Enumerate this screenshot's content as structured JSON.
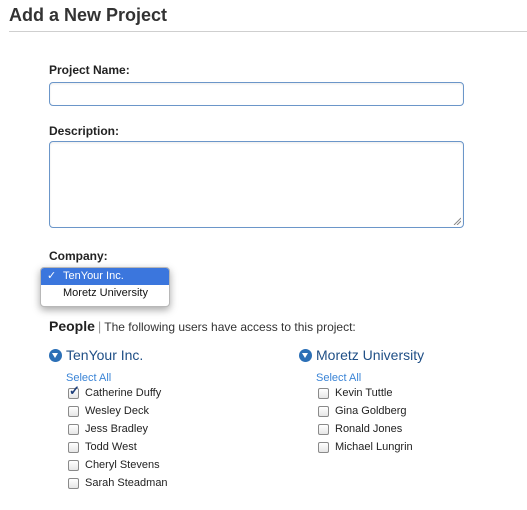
{
  "page": {
    "title": "Add a New Project"
  },
  "form": {
    "project_name_label": "Project Name:",
    "project_name_value": "",
    "description_label": "Description:",
    "description_value": "",
    "company_label": "Company:",
    "company_options": [
      "TenYour Inc.",
      "Moretz University"
    ],
    "company_selected": "TenYour Inc.",
    "checkmark": "✓"
  },
  "people": {
    "heading": "People",
    "separator": "|",
    "description": "The following users have access to this project:",
    "groups": [
      {
        "name": "TenYour Inc.",
        "select_all": "Select All",
        "members": [
          {
            "name": "Catherine Duffy",
            "checked": true
          },
          {
            "name": "Wesley Deck",
            "checked": false
          },
          {
            "name": "Jess Bradley",
            "checked": false
          },
          {
            "name": "Todd West",
            "checked": false
          },
          {
            "name": "Cheryl Stevens",
            "checked": false
          },
          {
            "name": "Sarah Steadman",
            "checked": false
          }
        ]
      },
      {
        "name": "Moretz University",
        "select_all": "Select All",
        "members": [
          {
            "name": "Kevin Tuttle",
            "checked": false
          },
          {
            "name": "Gina Goldberg",
            "checked": false
          },
          {
            "name": "Ronald Jones",
            "checked": false
          },
          {
            "name": "Michael Lungrin",
            "checked": false
          }
        ]
      }
    ]
  },
  "colors": {
    "accent": "#2b6fb6",
    "link": "#3a84d6",
    "selection": "#3b76dd",
    "input_border": "#6b96c9"
  }
}
